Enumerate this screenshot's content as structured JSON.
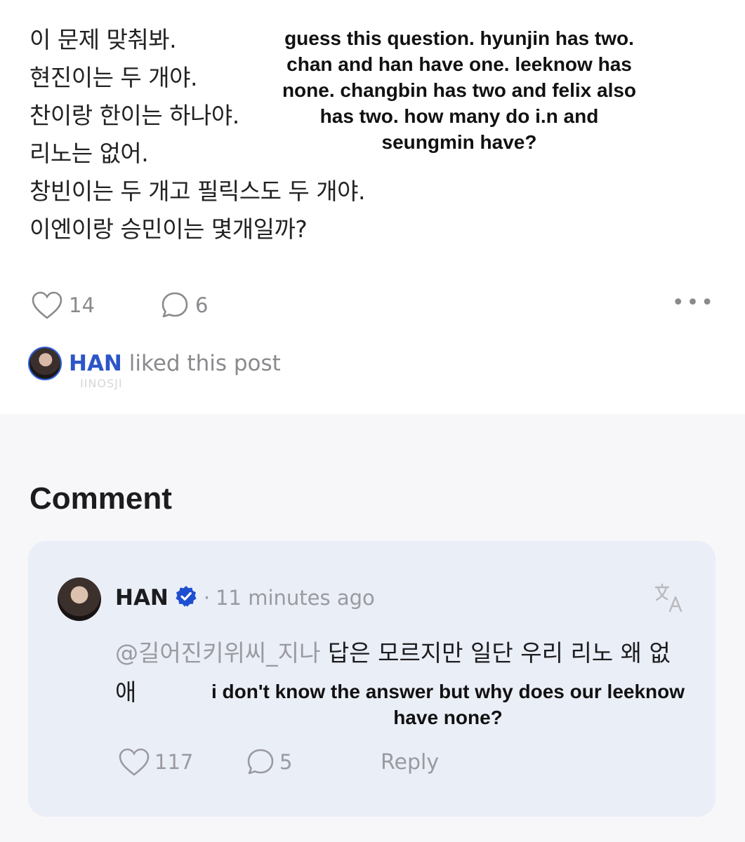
{
  "post": {
    "korean_lines": [
      "이 문제 맞춰봐.",
      "현진이는 두 개야.",
      "찬이랑 한이는 하나야.",
      "리노는 없어.",
      "창빈이는 두 개고 필릭스도 두 개야.",
      "이엔이랑 승민이는 몇개일까?"
    ],
    "translation": "guess this question. hyunjin has two. chan and han have one. leeknow has none. changbin has two and felix also has two. how many do i.n and seungmin have?",
    "like_count": "14",
    "comment_count": "6",
    "more_label": "•••",
    "liked_by": {
      "name": "HAN",
      "text": " liked this post"
    },
    "watermark": "IINOSJI"
  },
  "comments_section": {
    "heading": "Comment",
    "comment": {
      "author": "HAN",
      "verified_badge_icon": "verified-badge-icon",
      "separator": "·",
      "time": "11 minutes ago",
      "mention": "@길어진키위씨_지나",
      "body": " 답은 모르지만 일단 우리 리노 왜 없애",
      "translation": "i don't know the answer but why does our leeknow have none?",
      "like_count": "117",
      "reply_count": "5",
      "reply_label": "Reply"
    }
  },
  "colors": {
    "accent_blue": "#2c56c7",
    "badge_blue": "#1f4fd1",
    "card_bg": "#eaeef7",
    "muted_text": "#8a8a8e"
  }
}
